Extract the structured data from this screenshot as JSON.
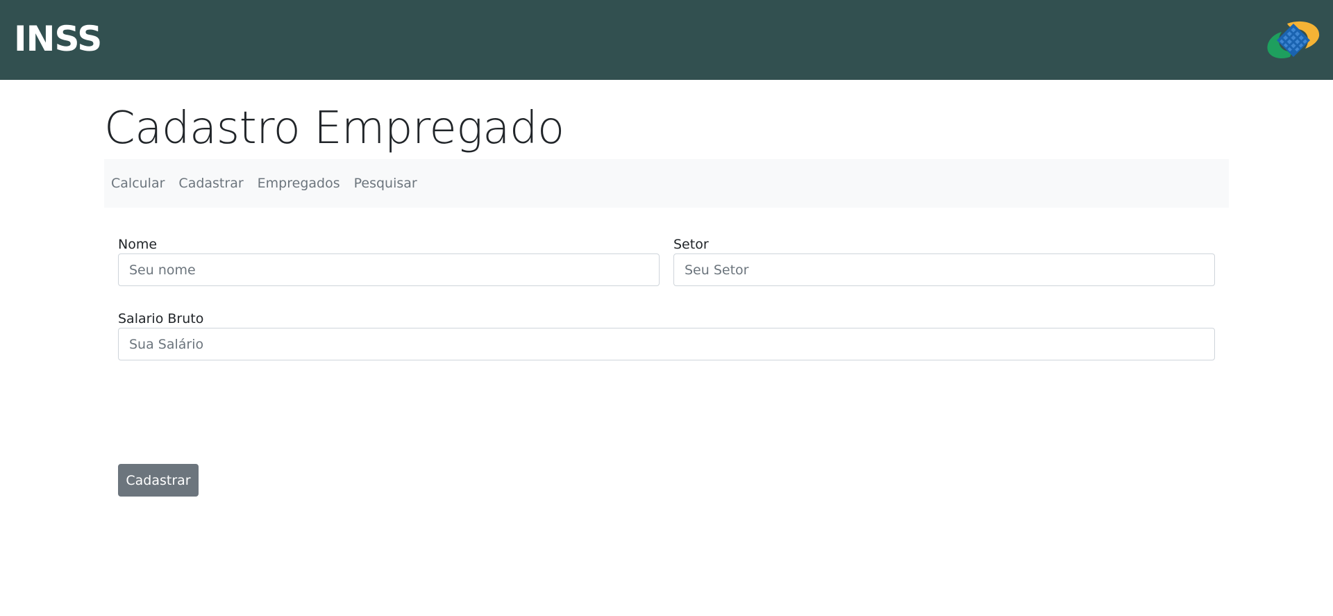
{
  "header": {
    "brand": "INSS",
    "logo_icon": "inss-logo-icon",
    "background": "#325050"
  },
  "page": {
    "title": "Cadastro Empregado"
  },
  "nav": {
    "items": [
      {
        "label": "Calcular"
      },
      {
        "label": "Cadastrar"
      },
      {
        "label": "Empregados"
      },
      {
        "label": "Pesquisar"
      }
    ]
  },
  "form": {
    "nome": {
      "label": "Nome",
      "placeholder": "Seu nome",
      "value": ""
    },
    "setor": {
      "label": "Setor",
      "placeholder": "Seu Setor",
      "value": ""
    },
    "salario": {
      "label": "Salario Bruto",
      "placeholder": "Sua Salário",
      "value": ""
    },
    "submit_label": "Cadastrar",
    "button_color": "#6c757d"
  }
}
